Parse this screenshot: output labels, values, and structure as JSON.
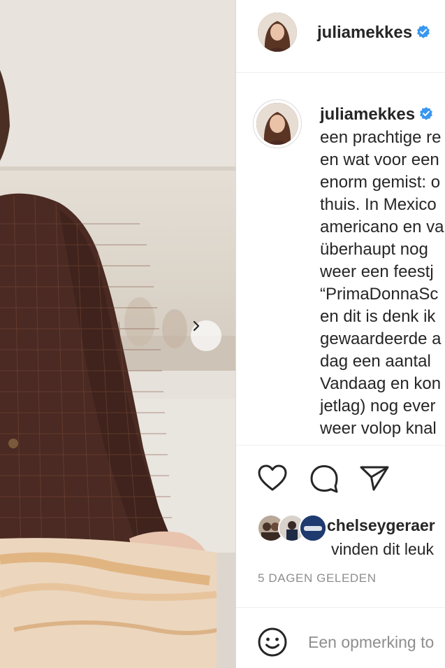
{
  "post": {
    "username": "juliamekkes",
    "verified": true,
    "caption_lines": [
      "een prachtige re",
      "en wat voor een",
      "enorm gemist: o",
      "thuis. In Mexico",
      "americano en va",
      "überhaupt nog",
      "weer een feestj",
      "“PrimaDonnaSc",
      "en dit is denk ik",
      "gewaardeerde a",
      "dag een aantal",
      "Vandaag en kon",
      "jetlag) nog ever",
      "weer volop knal"
    ]
  },
  "actions": {
    "like_icon": "heart-icon",
    "comment_icon": "comment-bubble-icon",
    "share_icon": "paper-plane-icon"
  },
  "likes": {
    "username": "chelseygeraer",
    "text": "vinden dit leuk"
  },
  "timestamp": "5 DAGEN GELEDEN",
  "comment": {
    "placeholder": "Een opmerking to",
    "emoji_icon": "smiley-icon"
  },
  "colors": {
    "verified": "#3897f0",
    "border": "#dbdbdb",
    "secondary_text": "#8e8e8e"
  }
}
